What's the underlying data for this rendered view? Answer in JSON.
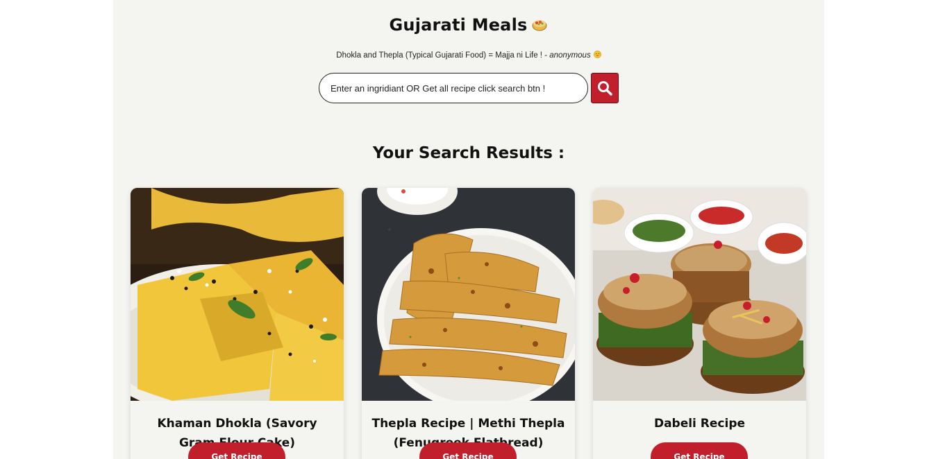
{
  "header": {
    "title": "Gujarati Meals",
    "title_icon": "food-bowl-icon",
    "quote_text": "Dhokla and Thepla (Typical Gujarati Food) = Majja ni Life ! - ",
    "quote_author": "anonymous",
    "quote_icon": "smile-emoji-icon"
  },
  "search": {
    "placeholder": "Enter an ingridiant OR Get all recipe click search btn !",
    "value": "",
    "button_icon": "search-icon"
  },
  "results": {
    "heading": "Your Search Results :",
    "button_label": "Get Recipe",
    "items": [
      {
        "title": "Khaman Dhokla (Savory Gram Flour Cake)",
        "image": "dhokla-photo"
      },
      {
        "title": "Thepla Recipe | Methi Thepla (Fenugreek Flatbread)",
        "image": "thepla-photo"
      },
      {
        "title": "Dabeli Recipe",
        "image": "dabeli-photo"
      }
    ]
  },
  "colors": {
    "accent": "#c21f2d",
    "page_background": "#f4f4f1",
    "text": "#111111"
  }
}
